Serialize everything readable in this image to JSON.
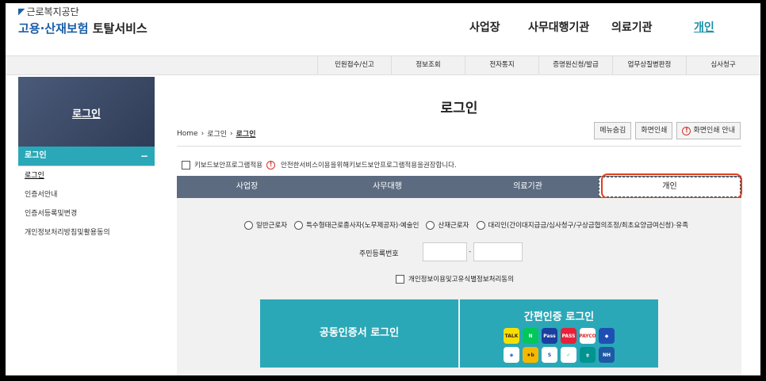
{
  "header": {
    "org": "근로복지공단",
    "service_main": "고용·산재보험",
    "service_suffix": "토탈서비스",
    "gnb": [
      "사업장",
      "사무대행기관",
      "의료기관",
      "개인"
    ]
  },
  "subnav": [
    "민원접수/신고",
    "정보조회",
    "전자통지",
    "증명원신청/발급",
    "업무상질병판정",
    "심사청구"
  ],
  "sidebar": {
    "hero_title": "로그인",
    "menu_head": "로그인",
    "items": [
      "로그인",
      "인증서안내",
      "인증서등록및변경",
      "개인정보처리방침및활용동의"
    ]
  },
  "main": {
    "title": "로그인",
    "breadcrumb": [
      "Home",
      "로그인",
      "로그인"
    ],
    "tools": [
      "메뉴숨김",
      "화면인쇄",
      "화면인쇄 안내"
    ],
    "keyboard_label": "키보드보안프로그램적용",
    "keyboard_notice": "안전한서비스이용을위해키보드보안프로그램적용을권장합니다.",
    "tabs": [
      "사업장",
      "사무대행",
      "의료기관",
      "개인"
    ],
    "radios": [
      "일반근로자",
      "특수형태근로종사자(노무제공자)·예술인",
      "산재근로자",
      "대리인(간이대지급금/심사청구/구상금협의조정/최초요양급여신청)·유족"
    ],
    "ssn_label": "주민등록번호",
    "consent": "개인정보이용및고유식별정보처리동의",
    "cert_login": "공동인증서 로그인",
    "simple_login": "간편인증 로그인",
    "simple_icons": [
      {
        "name": "kakao-icon",
        "label": "TALK",
        "color": "#f7e000",
        "text": "#3b1e1e"
      },
      {
        "name": "naver-icon",
        "label": "N",
        "color": "#03c75a",
        "text": "#ffffff"
      },
      {
        "name": "samsung-pass-icon",
        "label": "Pass",
        "color": "#1b3fa0",
        "text": "#ffffff"
      },
      {
        "name": "pass-icon",
        "label": "PASS",
        "color": "#e8203a",
        "text": "#ffffff"
      },
      {
        "name": "payco-icon",
        "label": "PAYCO",
        "color": "#ffffff",
        "text": "#e3292b"
      },
      {
        "name": "shield-auth-icon",
        "label": "◆",
        "color": "#1f4fb4",
        "text": "#ffffff"
      },
      {
        "name": "toss-icon",
        "label": "◆",
        "color": "#ffffff",
        "text": "#2f7bf6"
      },
      {
        "name": "kb-icon",
        "label": "★b",
        "color": "#f5b800",
        "text": "#3b2f00"
      },
      {
        "name": "shinhan-icon",
        "label": "S",
        "color": "#ffffff",
        "text": "#1f4fb4"
      },
      {
        "name": "banksalad-icon",
        "label": "✓",
        "color": "#ffffff",
        "text": "#2bb673"
      },
      {
        "name": "hana-icon",
        "label": "ㅎ",
        "color": "#009490",
        "text": "#ffffff"
      },
      {
        "name": "nh-icon",
        "label": "NH",
        "color": "#1d59a6",
        "text": "#ffffff"
      }
    ]
  }
}
